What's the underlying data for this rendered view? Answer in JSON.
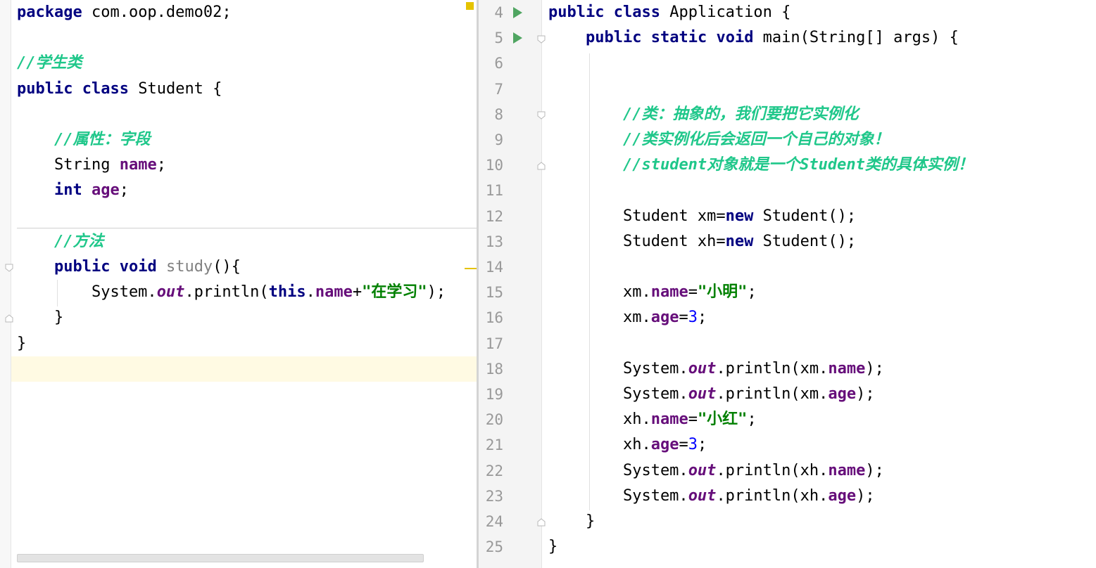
{
  "left_editor": {
    "lines": [
      {
        "tokens": [
          {
            "t": "package",
            "c": "kw"
          },
          {
            "t": " com.oop.demo02;"
          }
        ]
      },
      {
        "tokens": []
      },
      {
        "tokens": [
          {
            "t": "//学生类",
            "c": "cm"
          }
        ]
      },
      {
        "tokens": [
          {
            "t": "public",
            "c": "kw"
          },
          {
            "t": " "
          },
          {
            "t": "class",
            "c": "kw"
          },
          {
            "t": " Student {"
          }
        ]
      },
      {
        "tokens": []
      },
      {
        "tokens": [
          {
            "t": "    "
          },
          {
            "t": "//属性：字段",
            "c": "cm"
          }
        ]
      },
      {
        "tokens": [
          {
            "t": "    String "
          },
          {
            "t": "name",
            "c": "field"
          },
          {
            "t": ";"
          }
        ]
      },
      {
        "tokens": [
          {
            "t": "    "
          },
          {
            "t": "int",
            "c": "kw"
          },
          {
            "t": " "
          },
          {
            "t": "age",
            "c": "field"
          },
          {
            "t": ";"
          }
        ]
      },
      {
        "tokens": []
      },
      {
        "tokens": [
          {
            "t": "    "
          },
          {
            "t": "//方法",
            "c": "cm"
          }
        ]
      },
      {
        "tokens": [
          {
            "t": "    "
          },
          {
            "t": "public",
            "c": "kw"
          },
          {
            "t": " "
          },
          {
            "t": "void",
            "c": "kw"
          },
          {
            "t": " "
          },
          {
            "t": "study",
            "c": "unused"
          },
          {
            "t": "(){"
          }
        ]
      },
      {
        "tokens": [
          {
            "t": "        System."
          },
          {
            "t": "out",
            "c": "static"
          },
          {
            "t": ".println("
          },
          {
            "t": "this",
            "c": "kw"
          },
          {
            "t": "."
          },
          {
            "t": "name",
            "c": "field"
          },
          {
            "t": "+"
          },
          {
            "t": "\"在学习\"",
            "c": "str"
          },
          {
            "t": ");"
          }
        ]
      },
      {
        "tokens": [
          {
            "t": "    }"
          }
        ]
      },
      {
        "tokens": [
          {
            "t": "}"
          }
        ]
      }
    ]
  },
  "right_editor": {
    "first_line_number": 4,
    "lines": [
      {
        "tokens": [
          {
            "t": "public",
            "c": "kw"
          },
          {
            "t": " "
          },
          {
            "t": "class",
            "c": "kw"
          },
          {
            "t": " Application {"
          }
        ]
      },
      {
        "tokens": [
          {
            "t": "    "
          },
          {
            "t": "public",
            "c": "kw"
          },
          {
            "t": " "
          },
          {
            "t": "static",
            "c": "kw"
          },
          {
            "t": " "
          },
          {
            "t": "void",
            "c": "kw"
          },
          {
            "t": " main(String[] args) {"
          }
        ]
      },
      {
        "tokens": []
      },
      {
        "tokens": []
      },
      {
        "tokens": [
          {
            "t": "        "
          },
          {
            "t": "//类：抽象的，我们要把它实例化",
            "c": "cm"
          }
        ]
      },
      {
        "tokens": [
          {
            "t": "        "
          },
          {
            "t": "//类实例化后会返回一个自己的对象！",
            "c": "cm"
          }
        ]
      },
      {
        "tokens": [
          {
            "t": "        "
          },
          {
            "t": "//student对象就是一个Student类的具体实例！",
            "c": "cm"
          }
        ]
      },
      {
        "tokens": []
      },
      {
        "tokens": [
          {
            "t": "        Student xm="
          },
          {
            "t": "new",
            "c": "kw"
          },
          {
            "t": " Student();"
          }
        ]
      },
      {
        "tokens": [
          {
            "t": "        Student xh="
          },
          {
            "t": "new",
            "c": "kw"
          },
          {
            "t": " Student();"
          }
        ]
      },
      {
        "tokens": []
      },
      {
        "tokens": [
          {
            "t": "        xm."
          },
          {
            "t": "name",
            "c": "field"
          },
          {
            "t": "="
          },
          {
            "t": "\"小明\"",
            "c": "str"
          },
          {
            "t": ";"
          }
        ]
      },
      {
        "tokens": [
          {
            "t": "        xm."
          },
          {
            "t": "age",
            "c": "field"
          },
          {
            "t": "="
          },
          {
            "t": "3",
            "c": "num"
          },
          {
            "t": ";"
          }
        ]
      },
      {
        "tokens": []
      },
      {
        "tokens": [
          {
            "t": "        System."
          },
          {
            "t": "out",
            "c": "static"
          },
          {
            "t": ".println(xm."
          },
          {
            "t": "name",
            "c": "field"
          },
          {
            "t": ");"
          }
        ]
      },
      {
        "tokens": [
          {
            "t": "        System."
          },
          {
            "t": "out",
            "c": "static"
          },
          {
            "t": ".println(xm."
          },
          {
            "t": "age",
            "c": "field"
          },
          {
            "t": ");"
          }
        ]
      },
      {
        "tokens": [
          {
            "t": "        xh."
          },
          {
            "t": "name",
            "c": "field"
          },
          {
            "t": "="
          },
          {
            "t": "\"小红\"",
            "c": "str"
          },
          {
            "t": ";"
          }
        ]
      },
      {
        "tokens": [
          {
            "t": "        xh."
          },
          {
            "t": "age",
            "c": "field"
          },
          {
            "t": "="
          },
          {
            "t": "3",
            "c": "num"
          },
          {
            "t": ";"
          }
        ]
      },
      {
        "tokens": [
          {
            "t": "        System."
          },
          {
            "t": "out",
            "c": "static"
          },
          {
            "t": ".println(xh."
          },
          {
            "t": "name",
            "c": "field"
          },
          {
            "t": ");"
          }
        ]
      },
      {
        "tokens": [
          {
            "t": "        System."
          },
          {
            "t": "out",
            "c": "static"
          },
          {
            "t": ".println(xh."
          },
          {
            "t": "age",
            "c": "field"
          },
          {
            "t": ");"
          }
        ]
      },
      {
        "tokens": [
          {
            "t": "    }"
          }
        ]
      },
      {
        "tokens": [
          {
            "t": "}"
          }
        ]
      }
    ]
  },
  "gutter_icons": {
    "run_lines": [
      4,
      5
    ],
    "run_icon": "run-arrow-icon",
    "fold_icon": "fold-marker-icon"
  },
  "colors": {
    "keyword": "#000080",
    "field": "#660e7a",
    "string": "#008000",
    "number": "#0000ff",
    "comment": "#1fc78a",
    "run_icon": "#4fa561",
    "warning_marker": "#e5c300",
    "cursor_line": "#fffae3"
  }
}
